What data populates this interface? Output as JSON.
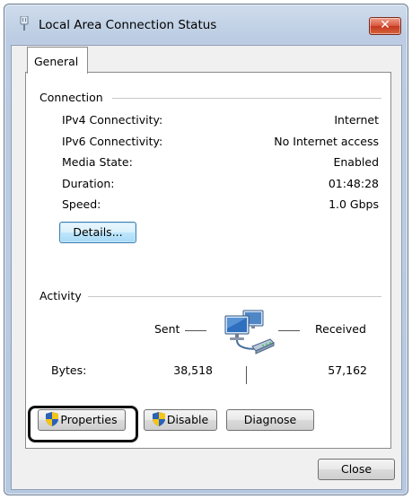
{
  "window": {
    "title": "Local Area Connection Status",
    "close_glyph": "✕"
  },
  "tabs": [
    {
      "label": "General",
      "active": true
    }
  ],
  "connection": {
    "group_label": "Connection",
    "rows": [
      {
        "label": "IPv4 Connectivity:",
        "value": "Internet"
      },
      {
        "label": "IPv6 Connectivity:",
        "value": "No Internet access"
      },
      {
        "label": "Media State:",
        "value": "Enabled"
      },
      {
        "label": "Duration:",
        "value": "01:48:28"
      },
      {
        "label": "Speed:",
        "value": "1.0 Gbps"
      }
    ],
    "details_button": "Details..."
  },
  "activity": {
    "group_label": "Activity",
    "sent_label": "Sent",
    "received_label": "Received",
    "bytes_label": "Bytes:",
    "bytes_sent": "38,518",
    "bytes_received": "57,162"
  },
  "buttons": {
    "properties": "Properties",
    "disable": "Disable",
    "diagnose": "Diagnose",
    "close": "Close"
  },
  "icons": {
    "app": "network-adapter-icon",
    "shield": "uac-shield-icon",
    "activity": "network-computers-icon"
  },
  "colors": {
    "highlight_ring": "#111111",
    "close_button": "#c4381f",
    "focus_border": "#3c7fb1"
  }
}
